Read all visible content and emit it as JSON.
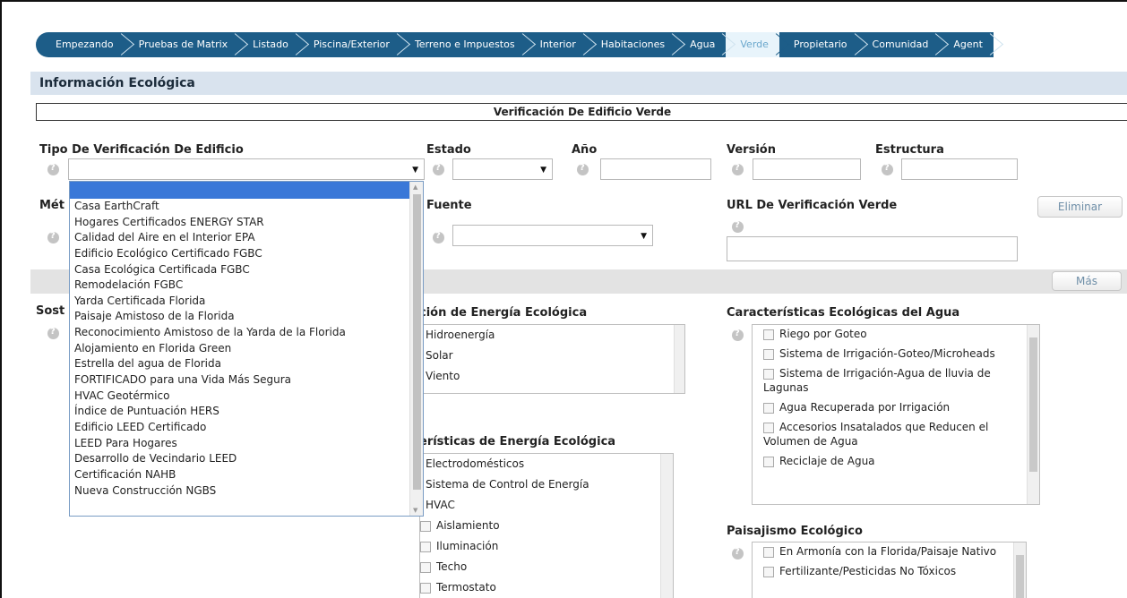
{
  "tabs": [
    {
      "label": "Empezando"
    },
    {
      "label": "Pruebas de Matrix"
    },
    {
      "label": "Listado"
    },
    {
      "label": "Piscina/Exterior"
    },
    {
      "label": "Terreno e Impuestos"
    },
    {
      "label": "Interior"
    },
    {
      "label": "Habitaciones"
    },
    {
      "label": "Agua"
    },
    {
      "label": "Verde"
    },
    {
      "label": "Propietario"
    },
    {
      "label": "Comunidad"
    },
    {
      "label": "Agent"
    }
  ],
  "active_tab": "Verde",
  "section_title": "Información Ecológica",
  "banner": "Verificación De Edificio Verde",
  "fields": {
    "tipo_label": "Tipo De Verificación De Edificio",
    "estado_label": "Estado",
    "anio_label": "Año",
    "version_label": "Versión",
    "estructura_label": "Estructura",
    "metodo_label": "Mét",
    "fuente_label": "Fuente",
    "url_label": "URL De Verificación Verde",
    "eliminar_button": "Eliminar",
    "mas_button": "Más",
    "sost_label": "Sost"
  },
  "energy_generation": {
    "label": "ción de Energía Ecológica",
    "items": [
      "Hidroenergía",
      "Solar",
      "Viento"
    ]
  },
  "energy_features": {
    "label": "erísticas de Energía Ecológica",
    "items_plain": [
      "Electrodomésticos",
      "Sistema de Control de Energía",
      "HVAC"
    ],
    "items_check": [
      "Aislamiento",
      "Iluminación",
      "Techo",
      "Termostato"
    ]
  },
  "water_features": {
    "label": "Características Ecológicas del Agua",
    "items": [
      "Riego por Goteo",
      "Sistema de Irrigación-Goteo/Microheads",
      "Sistema de Irrigación-Agua de lluvia de Lagunas",
      "Agua Recuperada por Irrigación",
      "Accesorios Insatalados que Reducen el Volumen de Agua",
      "Reciclaje de Agua"
    ]
  },
  "landscaping": {
    "label": "Paisajismo Ecológico",
    "items": [
      "En Armonía con la Florida/Paisaje Nativo",
      "Fertilizante/Pesticidas No Tóxicos"
    ]
  },
  "dropdown_options": [
    "Casa EarthCraft",
    "Hogares Certificados ENERGY STAR",
    "Calidad del Aire en el Interior EPA",
    "Edificio Ecológico Certificado FGBC",
    "Casa Ecológica Certificada FGBC",
    "Remodelación FGBC",
    "Yarda Certificada Florida",
    "Paisaje Amistoso de la Florida",
    "Reconocimiento Amistoso de la Yarda de la Florida",
    "Alojamiento en Florida Green",
    "Estrella del agua de Florida",
    "FORTIFICADO para una Vida Más Segura",
    "HVAC Geotérmico",
    "Índice de Puntuación HERS",
    "Edificio LEED Certificado",
    "LEED Para Hogares",
    "Desarrollo de Vecindario LEED",
    "Certificación NAHB",
    "Nueva Construcción NGBS"
  ]
}
